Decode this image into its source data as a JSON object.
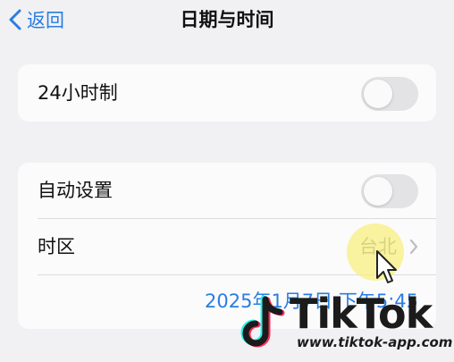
{
  "nav": {
    "back_label": "返回",
    "title": "日期与时间"
  },
  "card1": {
    "row_24h": {
      "label": "24小时制",
      "toggle_on": false
    }
  },
  "card2": {
    "row_auto": {
      "label": "自动设置",
      "toggle_on": false
    },
    "row_tz": {
      "label": "时区",
      "value": "台北"
    },
    "datetime": "2025年1月7日 下午5:45"
  },
  "colors": {
    "accent": "#2a7de1",
    "background": "#f1f1f3",
    "card": "#fbfbfc",
    "toggle_off": "#e3e3e6",
    "secondary_text": "#8e8e92",
    "tap_highlight": "#f8ee78"
  },
  "icons": {
    "back": "chevron-left-icon",
    "disclosure": "chevron-right-icon",
    "pointer": "mouse-cursor-icon"
  },
  "watermark": {
    "brand": "TikTok",
    "url": "www.tiktok-app.com"
  }
}
